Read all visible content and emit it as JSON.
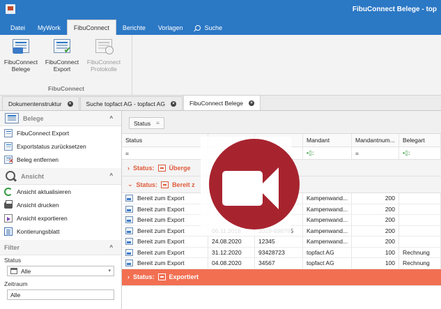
{
  "titlebar": {
    "title": "FibuConnect Belege - top"
  },
  "menu": {
    "items": [
      "Datei",
      "MyWork",
      "FibuConnect",
      "Berichte",
      "Vorlagen",
      "Suche"
    ],
    "active": "FibuConnect"
  },
  "ribbon": {
    "buttons": [
      {
        "line1": "FibuConnect",
        "line2": "Belege",
        "enabled": true
      },
      {
        "line1": "FibuConnect",
        "line2": "Export",
        "enabled": true
      },
      {
        "line1": "FibuConnect",
        "line2": "Protokolle",
        "enabled": false
      }
    ],
    "group_label": "FibuConnect"
  },
  "doc_tabs": [
    {
      "label": "Dokumentenstruktur",
      "active": false
    },
    {
      "label": "Suche topfact AG - topfact AG",
      "active": false
    },
    {
      "label": "FibuConnect Belege",
      "active": true
    }
  ],
  "left": {
    "belege_title": "Belege",
    "belege_actions": [
      "FibuConnect Export",
      "Exportstatus zurücksetzen",
      "Beleg entfernen"
    ],
    "ansicht_title": "Ansicht",
    "ansicht_actions": [
      "Ansicht aktualisieren",
      "Ansicht drucken",
      "Ansicht exportieren",
      "Kontierungsblatt"
    ],
    "filter_title": "Filter",
    "status_label": "Status",
    "status_value": "Alle",
    "zeitraum_label": "Zeitraum",
    "zeitraum_value": "Alle"
  },
  "grid": {
    "group_chip": "Status",
    "columns": [
      "Status",
      "",
      "",
      "Mandant",
      "Mandantnum...",
      "Belegart"
    ],
    "filter_tokens": [
      "=",
      "",
      "",
      "▪▯:",
      "=",
      "▪▯:"
    ],
    "groups": [
      {
        "label": "Status:",
        "value": "Überge",
        "collapsed": true
      },
      {
        "label": "Status:",
        "value": "Bereit z",
        "collapsed": false
      }
    ],
    "rows": [
      {
        "status": "Bereit zum Export",
        "date": "",
        "nr": "",
        "mandant": "Kampenwand...",
        "mnum": "200",
        "belegart": ""
      },
      {
        "status": "Bereit zum Export",
        "date": "",
        "nr": "",
        "mandant": "Kampenwand...",
        "mnum": "200",
        "belegart": ""
      },
      {
        "status": "Bereit zum Export",
        "date": "",
        "nr": "",
        "mandant": "Kampenwand...",
        "mnum": "200",
        "belegart": ""
      },
      {
        "status": "Bereit zum Export",
        "date": "06.11.2018",
        "nr": "2019-698795",
        "mandant": "Kampenwand...",
        "mnum": "200",
        "belegart": ""
      },
      {
        "status": "Bereit zum Export",
        "date": "24.08.2020",
        "nr": "12345",
        "mandant": "Kampenwand...",
        "mnum": "200",
        "belegart": ""
      },
      {
        "status": "Bereit zum Export",
        "date": "31.12.2020",
        "nr": "93428723",
        "mandant": "topfact AG",
        "mnum": "100",
        "belegart": "Rechnung"
      },
      {
        "status": "Bereit zum Export",
        "date": "04.08.2020",
        "nr": "34567",
        "mandant": "topfact AG",
        "mnum": "100",
        "belegart": "Rechnung"
      }
    ],
    "export_group": {
      "label": "Status:",
      "value": "Exportiert"
    }
  },
  "colors": {
    "accent": "#2b78c5",
    "group_text": "#e05a3a",
    "export_bar": "#f26f52",
    "record_red": "#a7242f"
  }
}
